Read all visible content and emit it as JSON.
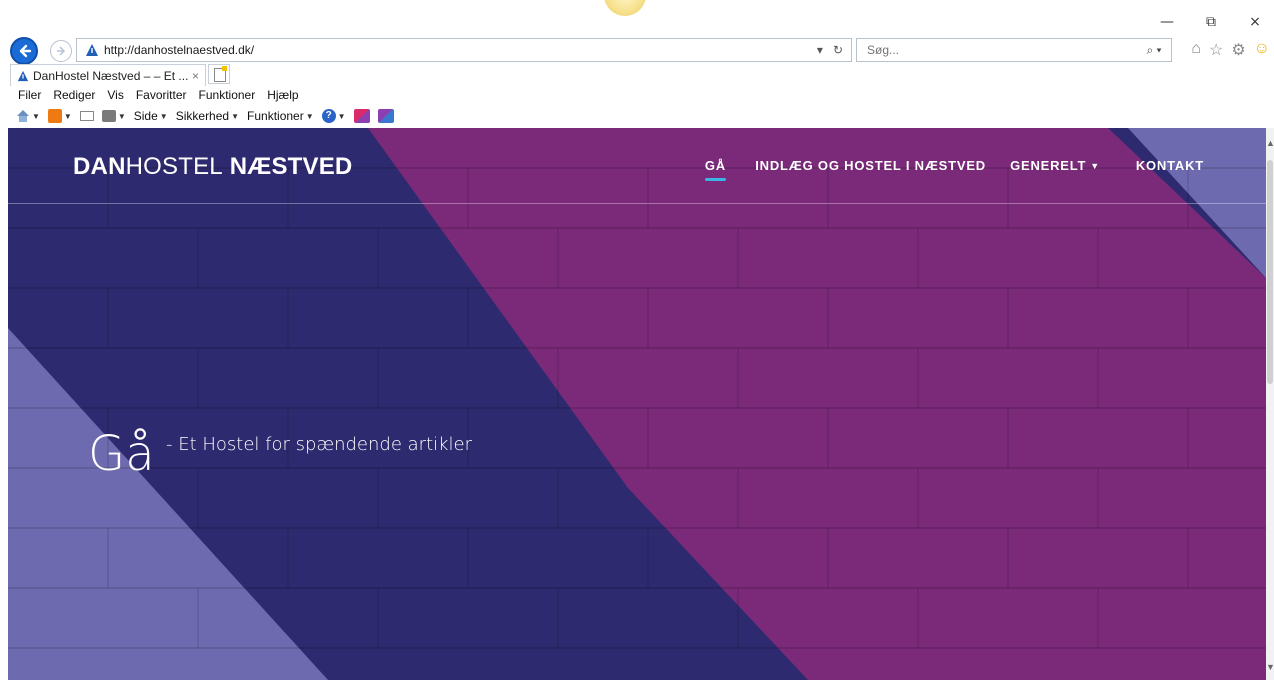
{
  "browser": {
    "url": "http://danhostelnaestved.dk/",
    "search_placeholder": "Søg...",
    "tab_title": "DanHostel Næstved – – Et ...",
    "tab_close": "×",
    "window_controls": {
      "minimize": "—",
      "restore": "⧉",
      "close": "×"
    },
    "menu": [
      "Filer",
      "Rediger",
      "Vis",
      "Favoritter",
      "Funktioner",
      "Hjælp"
    ],
    "command_bar": {
      "page": "Side",
      "security": "Sikkerhed",
      "tools": "Funktioner"
    },
    "icons": [
      "back-icon",
      "forward-icon",
      "home-icon",
      "favorites-star-icon",
      "settings-gear-icon",
      "smiley-feedback-icon",
      "rss-icon",
      "mail-icon",
      "print-icon",
      "help-icon",
      "research-icon"
    ]
  },
  "site": {
    "logo": {
      "part1": "DAN",
      "part2": "HOSTEL",
      "part3": "NÆSTVED"
    },
    "nav": [
      {
        "label": "GÅ",
        "active": true
      },
      {
        "label": "INDLÆG OG HOSTEL I NÆSTVED",
        "active": false
      },
      {
        "label": "GENERELT",
        "active": false,
        "has_dropdown": true
      },
      {
        "label": "KONTAKT",
        "active": false
      }
    ],
    "hero": {
      "title": "Gå",
      "subtitle": "- Et Hostel for spændende artikler"
    },
    "colors": {
      "indigo": "#2e2a6f",
      "magenta": "#7a2a78",
      "lavender": "#6e6ab0",
      "accent": "#3bb4e6"
    }
  }
}
